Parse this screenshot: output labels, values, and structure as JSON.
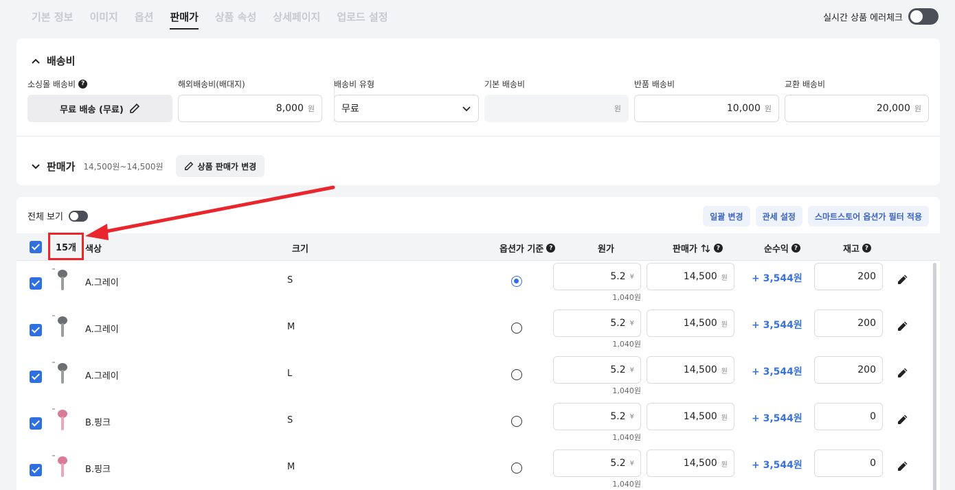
{
  "tabs": [
    {
      "label": "기본 정보"
    },
    {
      "label": "이미지"
    },
    {
      "label": "옵션"
    },
    {
      "label": "판매가"
    },
    {
      "label": "상품 속성"
    },
    {
      "label": "상세페이지"
    },
    {
      "label": "업로드 설정"
    }
  ],
  "active_tab": "판매가",
  "realtime_check": {
    "label": "실시간 상품 에러체크",
    "enabled": true
  },
  "shipping": {
    "title": "배송비",
    "mall_fee": {
      "label": "소싱몰 배송비",
      "value": "무료 배송 (무료)"
    },
    "overseas_fee": {
      "label": "해외배송비(배대지)",
      "value": "8,000",
      "unit": "원"
    },
    "fee_type": {
      "label": "배송비 유형",
      "value": "무료"
    },
    "base_fee": {
      "label": "기본 배송비",
      "value": "",
      "unit": "원"
    },
    "return_fee": {
      "label": "반품 배송비",
      "value": "10,000",
      "unit": "원"
    },
    "exchange_fee": {
      "label": "교환 배송비",
      "value": "20,000",
      "unit": "원"
    }
  },
  "price_section": {
    "title": "판매가",
    "range": "14,500원~14,500원",
    "change_button": "상품 판매가 변경"
  },
  "options_table": {
    "view_all": {
      "label": "전체 보기",
      "enabled": true
    },
    "actions": [
      "일괄 변경",
      "관세 설정",
      "스마트스토어 옵션가 필터 적용"
    ],
    "count": "15개",
    "headers": {
      "color": "색상",
      "size": "크기",
      "base": "옵션가 기준",
      "cost": "원가",
      "price": "판매가",
      "profit": "순수익",
      "stock": "재고"
    },
    "rows": [
      {
        "color": "A.그레이",
        "size": "S",
        "base": true,
        "cost": "5.2",
        "cost_unit": "¥",
        "cost_krw": "1,040원",
        "price": "14,500",
        "price_unit": "원",
        "profit": "+ 3,544원",
        "stock": "200",
        "thumb": "gray"
      },
      {
        "color": "A.그레이",
        "size": "M",
        "base": false,
        "cost": "5.2",
        "cost_unit": "¥",
        "cost_krw": "1,040원",
        "price": "14,500",
        "price_unit": "원",
        "profit": "+ 3,544원",
        "stock": "200",
        "thumb": "gray"
      },
      {
        "color": "A.그레이",
        "size": "L",
        "base": false,
        "cost": "5.2",
        "cost_unit": "¥",
        "cost_krw": "1,040원",
        "price": "14,500",
        "price_unit": "원",
        "profit": "+ 3,544원",
        "stock": "200",
        "thumb": "gray"
      },
      {
        "color": "B.핑크",
        "size": "S",
        "base": false,
        "cost": "5.2",
        "cost_unit": "¥",
        "cost_krw": "1,040원",
        "price": "14,500",
        "price_unit": "원",
        "profit": "+ 3,544원",
        "stock": "0",
        "thumb": "pink"
      },
      {
        "color": "B.핑크",
        "size": "M",
        "base": false,
        "cost": "5.2",
        "cost_unit": "¥",
        "cost_krw": "1,040원",
        "price": "14,500",
        "price_unit": "원",
        "profit": "+ 3,544원",
        "stock": "0",
        "thumb": "pink"
      }
    ]
  },
  "colors": {
    "accent": "#2f6fe0",
    "profit": "#3a74d8",
    "annotation": "#e8262b"
  }
}
